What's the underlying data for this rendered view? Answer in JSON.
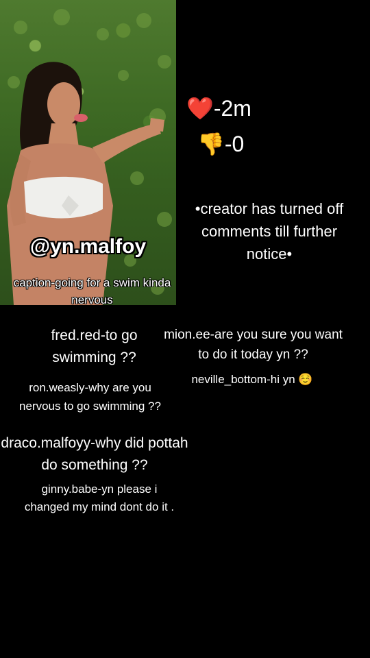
{
  "post": {
    "username": "@yn.malfoy",
    "caption": "caption-going for a swim kinda nervous"
  },
  "stats": {
    "likes": "❤️-2m",
    "dislikes": "👎-0"
  },
  "notice": "•creator has turned off comments till further notice•",
  "comments": [
    "fred.red-to go swimming ??",
    "mion.ee-are you sure you want to do it today yn ??",
    "neville_bottom-hi yn ☺️",
    "ron.weasly-why are you nervous to go swimming ??",
    "draco.malfoyy-why did pottah do something ??",
    "ginny.babe-yn please i changed my mind dont do it ."
  ]
}
